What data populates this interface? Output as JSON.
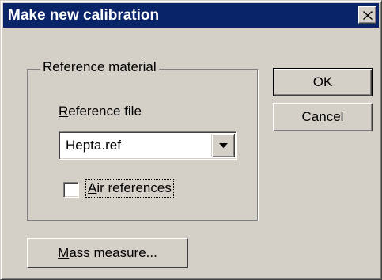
{
  "window": {
    "title": "Make new calibration"
  },
  "reference_group": {
    "legend": "Reference material",
    "file_label": "Reference file",
    "file_value": "Hepta.ref",
    "air_references_label": "Air references",
    "air_references_checked": false
  },
  "buttons": {
    "ok": "OK",
    "cancel": "Cancel",
    "mass_measure": "Mass measure..."
  },
  "colors": {
    "titlebar": "#0a246a",
    "face": "#d4d0c8"
  },
  "icons": {
    "close": "close-icon",
    "dropdown": "chevron-down-icon"
  }
}
